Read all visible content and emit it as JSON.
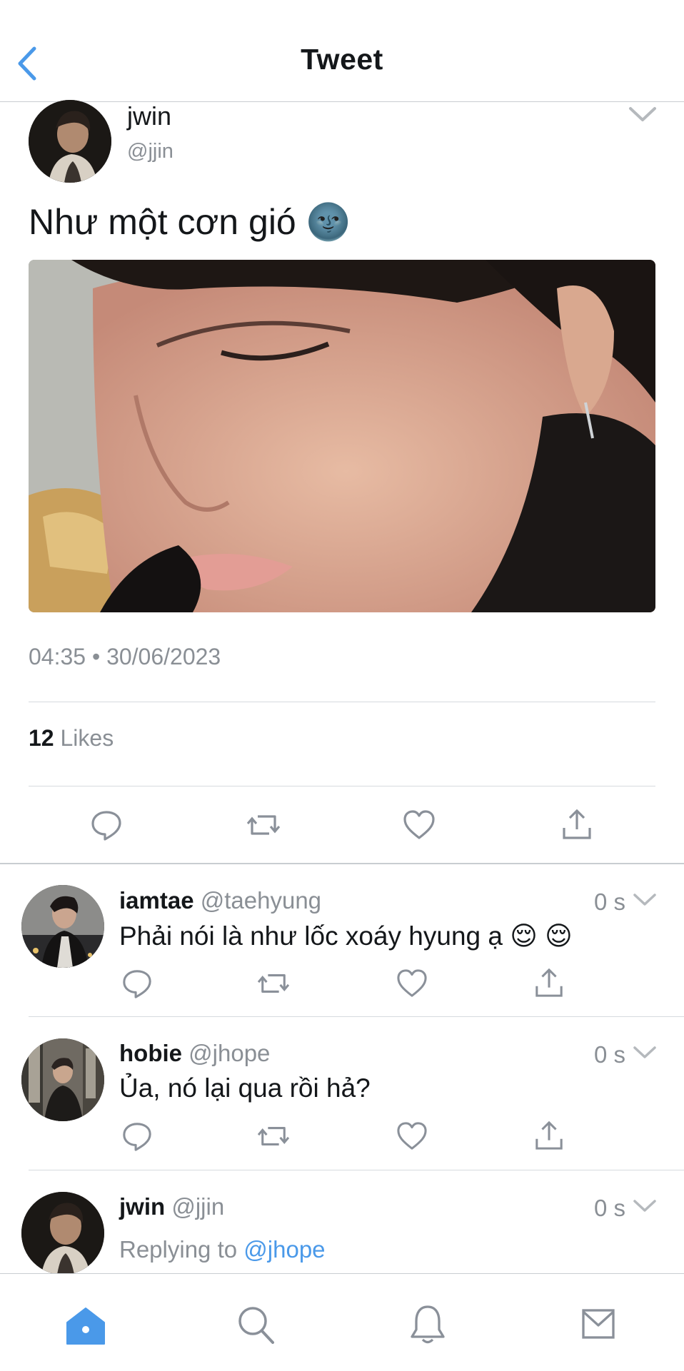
{
  "header": {
    "title": "Tweet",
    "back_icon": "chevron-left-icon"
  },
  "colors": {
    "accent": "#4a99e9",
    "secondary_text": "#8a8f95",
    "divider": "#d6dade"
  },
  "main_tweet": {
    "name": "jwin",
    "handle": "@jjin",
    "text": "Như một cơn gió 🌚",
    "time": "04:35 • 30/06/2023",
    "likes_count": "12",
    "likes_label": "Likes",
    "actions": [
      "reply-icon",
      "retweet-icon",
      "like-icon",
      "share-icon"
    ]
  },
  "replies": [
    {
      "name": "iamtae",
      "handle": "@taehyung",
      "time": "0 s",
      "text": "Phải nói là như lốc xoáy hyung ạ 😌 😌"
    },
    {
      "name": "hobie",
      "handle": "@jhope",
      "time": "0 s",
      "text": "Ủa, nó lại qua rồi hả?"
    },
    {
      "name": "jwin",
      "handle": "@jjin",
      "time": "0 s",
      "replying_label": "Replying to",
      "replying_to": "@jhope"
    }
  ],
  "tabbar": {
    "items": [
      "home-icon",
      "search-icon",
      "notifications-icon",
      "messages-icon"
    ],
    "active": "home-icon"
  }
}
